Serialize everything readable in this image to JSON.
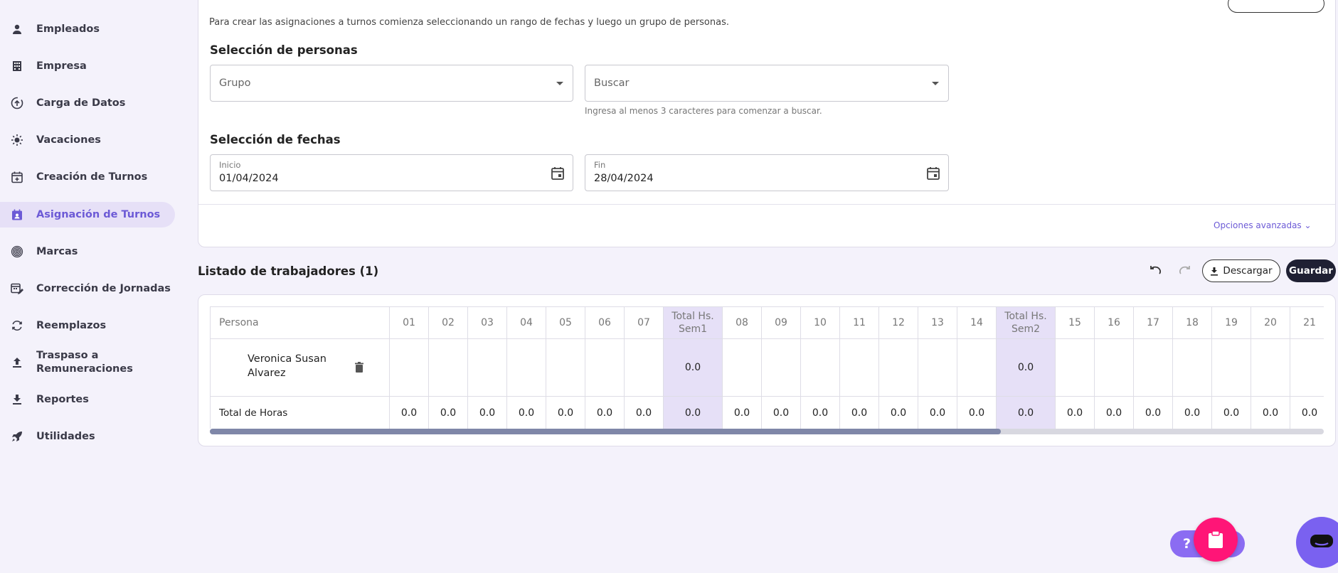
{
  "sidebar": {
    "items": [
      {
        "label": "Empleados",
        "icon": "person-icon"
      },
      {
        "label": "Empresa",
        "icon": "building-icon"
      },
      {
        "label": "Carga de Datos",
        "icon": "upload-icon"
      },
      {
        "label": "Vacaciones",
        "icon": "sun-icon"
      },
      {
        "label": "Creación de Turnos",
        "icon": "calendar-plus-icon"
      },
      {
        "label": "Asignación de Turnos",
        "icon": "calendar-person-icon",
        "active": true
      },
      {
        "label": "Marcas",
        "icon": "fingerprint-icon"
      },
      {
        "label": "Corrección de Jornadas",
        "icon": "edit-calendar-icon"
      },
      {
        "label": "Reemplazos",
        "icon": "swap-icon"
      },
      {
        "label_line1": "Traspaso a",
        "label_line2": "Remuneraciones",
        "icon": "upload-arrow-icon"
      },
      {
        "label": "Reportes",
        "icon": "download-icon"
      },
      {
        "label": "Utilidades",
        "icon": "rocket-icon"
      }
    ]
  },
  "assignment": {
    "intro": "Para crear las asignaciones a turnos comienza seleccionando un rango de fechas y luego un grupo de personas.",
    "people_title": "Selección de personas",
    "group_placeholder": "Grupo",
    "search_placeholder": "Buscar",
    "search_helper": "Ingresa al menos 3 caracteres para comenzar a buscar.",
    "dates_title": "Selección de fechas",
    "start_label": "Inicio",
    "start_value": "01/04/2024",
    "end_label": "Fin",
    "end_value": "28/04/2024",
    "advanced": "Opciones avanzadas"
  },
  "listing": {
    "title": "Listado de trabajadores (1)",
    "download": "Descargar",
    "save": "Guardar"
  },
  "table": {
    "person_header": "Persona",
    "columns": [
      "01",
      "02",
      "03",
      "04",
      "05",
      "06",
      "07",
      "Total Hs. Sem1",
      "08",
      "09",
      "10",
      "11",
      "12",
      "13",
      "14",
      "Total Hs. Sem2",
      "15",
      "16",
      "17",
      "18",
      "19",
      "20",
      "21"
    ],
    "rows": [
      {
        "name_line1": "Veronica Susan",
        "name_line2": "Alvarez",
        "cells": [
          "",
          "",
          "",
          "",
          "",
          "",
          "",
          "0.0",
          "",
          "",
          "",
          "",
          "",
          "",
          "",
          "0.0",
          "",
          "",
          "",
          "",
          "",
          "",
          ""
        ]
      }
    ],
    "footer_label": "Total de Horas",
    "footer": [
      "0.0",
      "0.0",
      "0.0",
      "0.0",
      "0.0",
      "0.0",
      "0.0",
      "0.0",
      "0.0",
      "0.0",
      "0.0",
      "0.0",
      "0.0",
      "0.0",
      "0.0",
      "0.0",
      "0.0",
      "0.0",
      "0.0",
      "0.0",
      "0.0",
      "0.0",
      "0.0"
    ]
  },
  "help": {
    "label": "?"
  },
  "colors": {
    "accent": "#6c5ad6",
    "active_bg": "#e6e0f7",
    "dark_button": "#1f2033",
    "pink": "#ff1577"
  }
}
